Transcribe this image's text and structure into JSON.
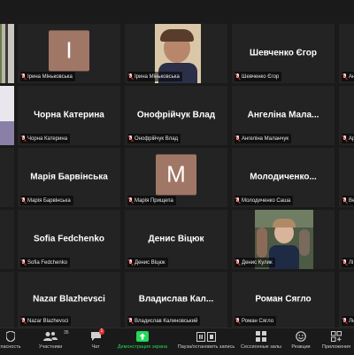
{
  "tiles": [
    {
      "caption": "",
      "kind": "video-left"
    },
    {
      "caption": "Ірина Міньковська",
      "initial": "I",
      "avatar_color": "#a07666"
    },
    {
      "caption": "Ірина Міньковська",
      "kind": "video-person"
    },
    {
      "name": "Шевченко Єгор",
      "caption": "Шевченко Єгор"
    },
    {
      "caption": "Ан"
    },
    {
      "kind": "video-left2"
    },
    {
      "name": "Чорна Катерина",
      "caption": "Чорна Катерина"
    },
    {
      "name": "Онофрійчук Влад",
      "caption": "Онофрійчук Влад"
    },
    {
      "name": "Ангеліна Мала...",
      "caption": "Ангеліна Маланчук"
    },
    {
      "caption": "Ар"
    },
    {
      "name": "Марія Барвінська",
      "caption": "Марія Барвінська"
    },
    {
      "caption": "Марія Прищепа",
      "initial": "M",
      "avatar_color": "#a07666"
    },
    {
      "name": "Молодиченко...",
      "caption": "Молодиченко Саша"
    },
    {
      "caption": "Ве"
    },
    {
      "name": "Sofia Fedchenko",
      "caption": "Sofia Fedchenko"
    },
    {
      "name": "Денис Віцюк",
      "caption": "Денис Віцюк"
    },
    {
      "caption": "Денис Кулик",
      "kind": "video-boy"
    },
    {
      "caption": "Лі"
    },
    {
      "name": "Nazar Blazhevsci",
      "caption": "Nazar Blazhevsci"
    },
    {
      "name": "Владислав Кал...",
      "caption": "Владислав Калиновський"
    },
    {
      "name": "Роман Сягло",
      "caption": "Роман Сягло"
    },
    {
      "caption": "Ли"
    }
  ],
  "toolbar": {
    "security": "пасность",
    "participants": "Участники",
    "participants_count": "35",
    "chat": "Чат",
    "chat_badge": "1",
    "share": "Демонстрация экрана",
    "pause_record": "Пауза/остановить запись",
    "breakout": "Сессионные залы",
    "reactions": "Реакции",
    "apps": "Приложения",
    "share_color": "#23d959"
  }
}
